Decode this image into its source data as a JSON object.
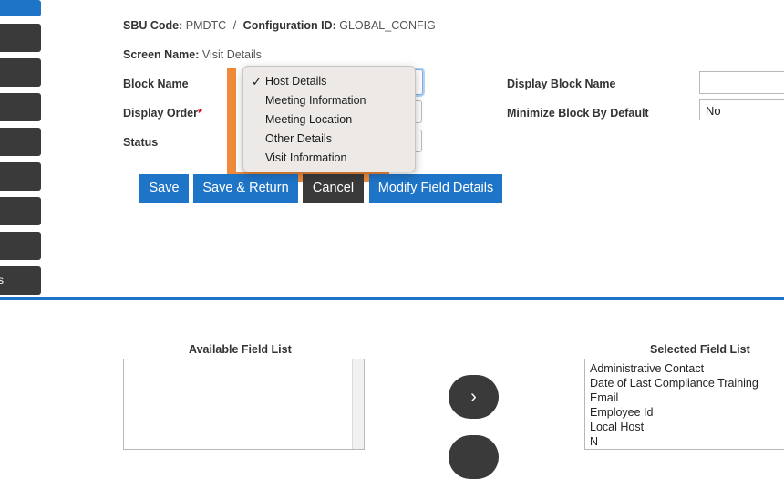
{
  "header": {
    "sbu_label": "SBU Code:",
    "sbu_value": "PMDTC",
    "separator": "/",
    "config_label": "Configuration ID:",
    "config_value": "GLOBAL_CONFIG",
    "screen_label": "Screen Name:",
    "screen_value": "Visit Details"
  },
  "sidebar": {
    "items": [
      {
        "label": ""
      },
      {
        "label": ""
      },
      {
        "label": ""
      },
      {
        "label": ""
      },
      {
        "label": ""
      },
      {
        "label": ""
      },
      {
        "label": ""
      },
      {
        "label": ""
      },
      {
        "label": "s"
      }
    ]
  },
  "form": {
    "block_name_label": "Block Name",
    "display_order_label": "Display Order",
    "required_mark": "*",
    "status_label": "Status",
    "display_block_name_label": "Display Block Name",
    "display_block_name_value": "",
    "minimize_label": "Minimize Block By Default",
    "minimize_value": "No"
  },
  "dropdown": {
    "check": "✓",
    "options": [
      "Host Details",
      "Meeting Information",
      "Meeting Location",
      "Other Details",
      "Visit Information"
    ],
    "selected": "Host Details"
  },
  "buttons": {
    "save": "Save",
    "save_return": "Save & Return",
    "cancel": "Cancel",
    "modify": "Modify Field Details"
  },
  "lists": {
    "available_title": "Available Field List",
    "selected_title": "Selected Field List",
    "selected_items": [
      "Administrative Contact",
      "Date of Last Compliance Training",
      "Email",
      "Employee Id",
      "Local Host",
      "N"
    ],
    "move_right_icon": "›"
  },
  "colors": {
    "primary": "#1e74c7",
    "dark": "#3a3a3a",
    "highlight": "#ee8a3a",
    "required": "#d0021b"
  }
}
